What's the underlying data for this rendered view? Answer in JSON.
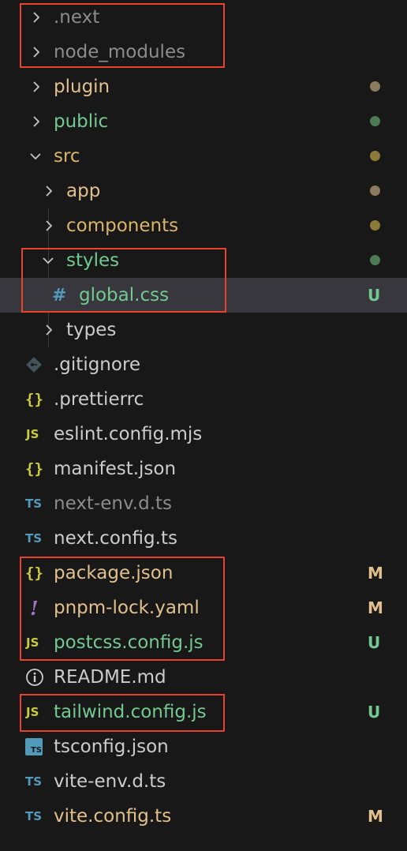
{
  "explorer": {
    "items": [
      {
        "label": ".next",
        "type": "folder",
        "expanded": false
      },
      {
        "label": "node_modules",
        "type": "folder",
        "expanded": false
      },
      {
        "label": "plugin",
        "type": "folder",
        "expanded": false,
        "status_dot": "#8c7a5e"
      },
      {
        "label": "public",
        "type": "folder",
        "expanded": false,
        "status_dot": "#4f7a58"
      },
      {
        "label": "src",
        "type": "folder",
        "expanded": true,
        "status_dot": "#8c7a3a"
      },
      {
        "label": "app",
        "type": "folder",
        "expanded": false,
        "status_dot": "#8c7a5e"
      },
      {
        "label": "components",
        "type": "folder",
        "expanded": false,
        "status_dot": "#8c7a3a"
      },
      {
        "label": "styles",
        "type": "folder",
        "expanded": true,
        "status_dot": "#4f7a58"
      },
      {
        "label": "global.css",
        "type": "file",
        "icon": "css-hash-icon",
        "icon_text": "#",
        "status": "U",
        "selected": true
      },
      {
        "label": "types",
        "type": "folder",
        "expanded": false
      },
      {
        "label": ".gitignore",
        "type": "file",
        "icon": "git-diamond-icon"
      },
      {
        "label": ".prettierrc",
        "type": "file",
        "icon": "json-braces-icon",
        "icon_text": "{}"
      },
      {
        "label": "eslint.config.mjs",
        "type": "file",
        "icon": "js-file-icon",
        "icon_text": "JS"
      },
      {
        "label": "manifest.json",
        "type": "file",
        "icon": "json-braces-icon",
        "icon_text": "{}"
      },
      {
        "label": "next-env.d.ts",
        "type": "file",
        "icon": "ts-file-icon",
        "icon_text": "TS"
      },
      {
        "label": "next.config.ts",
        "type": "file",
        "icon": "ts-file-icon",
        "icon_text": "TS"
      },
      {
        "label": "package.json",
        "type": "file",
        "icon": "json-braces-icon",
        "icon_text": "{}",
        "status": "M"
      },
      {
        "label": "pnpm-lock.yaml",
        "type": "file",
        "icon": "yaml-exclamation-icon",
        "icon_text": "!",
        "status": "M"
      },
      {
        "label": "postcss.config.js",
        "type": "file",
        "icon": "js-file-icon",
        "icon_text": "JS",
        "status": "U"
      },
      {
        "label": "README.md",
        "type": "file",
        "icon": "info-circle-icon"
      },
      {
        "label": "tailwind.config.js",
        "type": "file",
        "icon": "js-file-icon",
        "icon_text": "JS",
        "status": "U"
      },
      {
        "label": "tsconfig.json",
        "type": "file",
        "icon": "tsconfig-file-icon",
        "icon_text": "TS"
      },
      {
        "label": "vite-env.d.ts",
        "type": "file",
        "icon": "ts-file-icon",
        "icon_text": "TS"
      },
      {
        "label": "vite.config.ts",
        "type": "file",
        "icon": "ts-file-icon",
        "icon_text": "TS",
        "status": "M"
      }
    ]
  },
  "colors": {
    "highlight_box": "#e8412d",
    "modified": "#e2c08d",
    "untracked": "#73c991",
    "ignored": "#8c8c8c",
    "selected_row": "#37373d"
  }
}
